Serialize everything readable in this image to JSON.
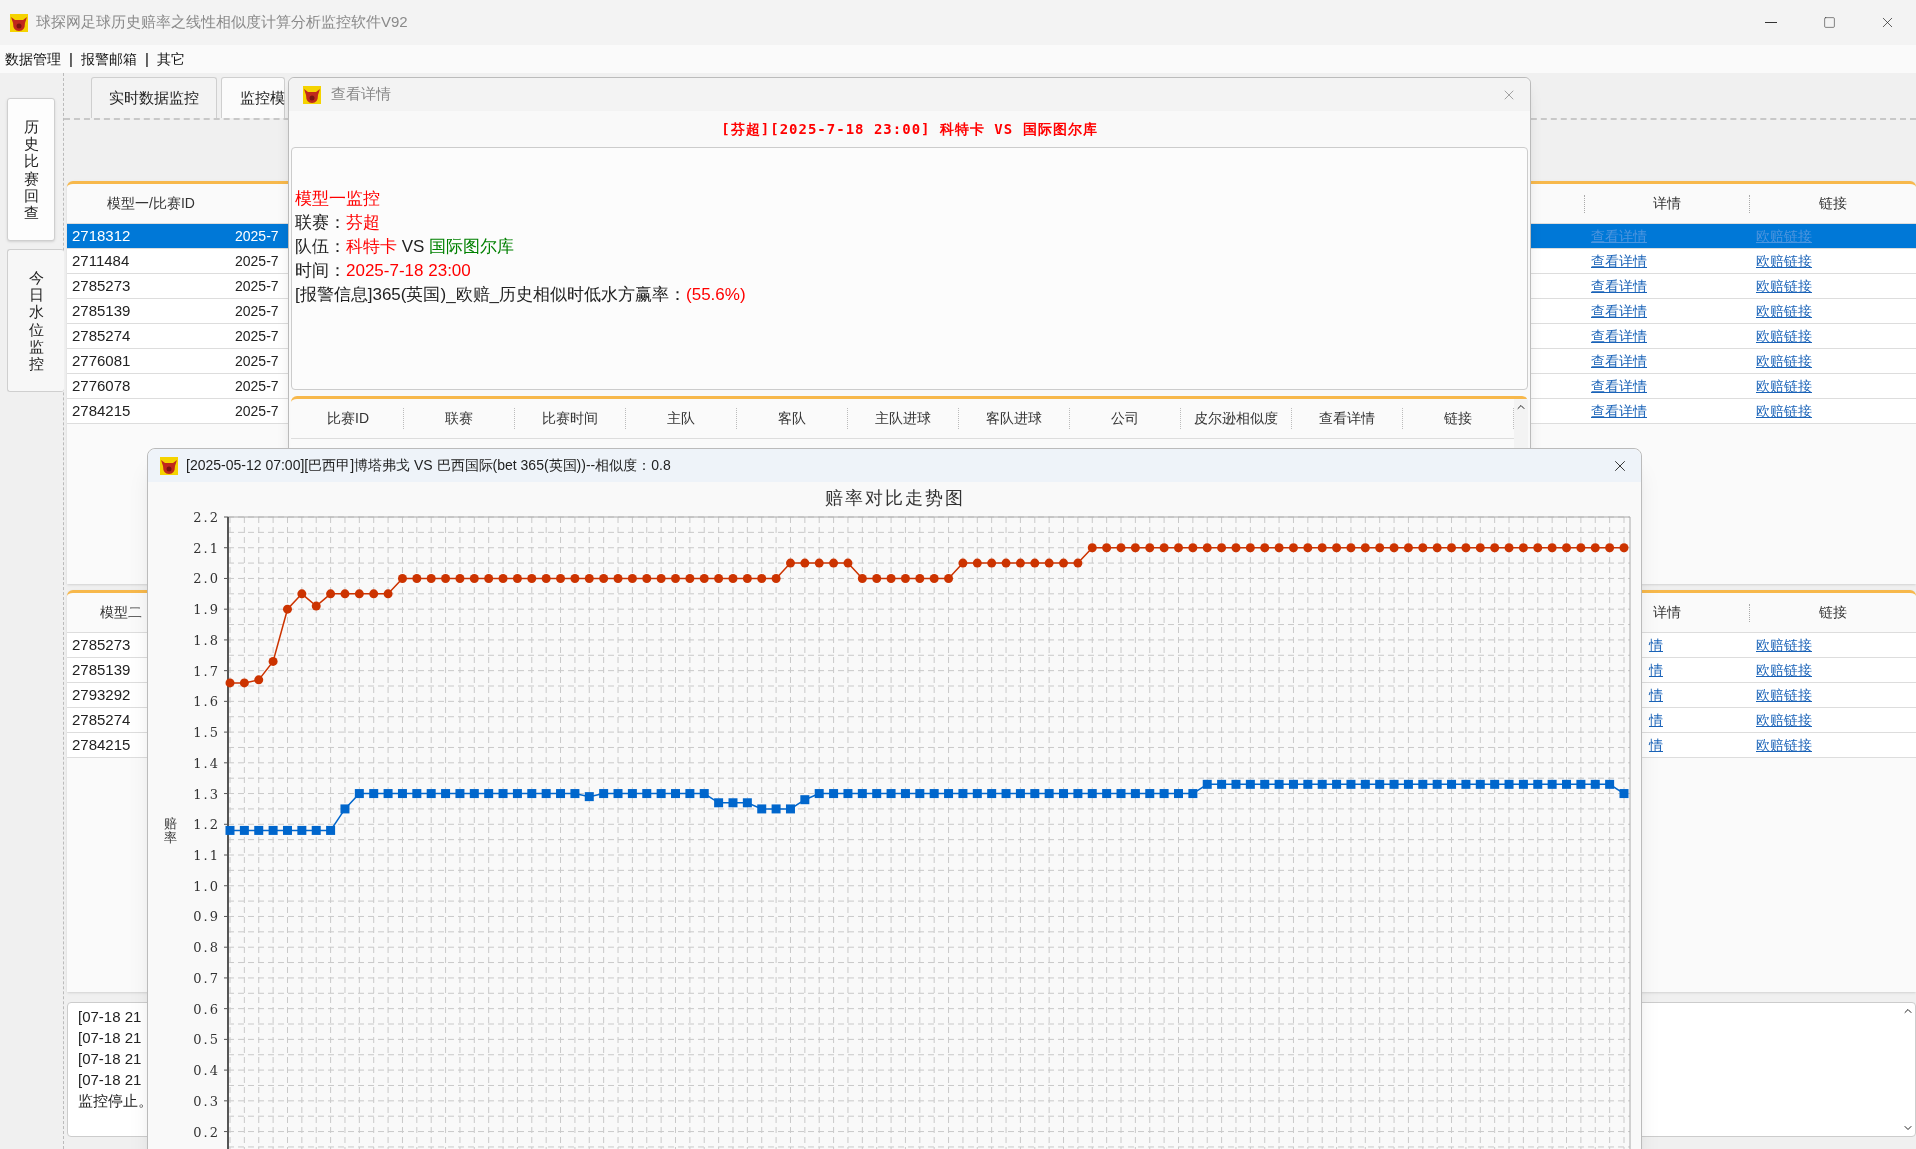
{
  "window": {
    "title": "球探网足球历史赔率之线性相似度计算分析监控软件V92"
  },
  "menu": [
    {
      "kind": "item",
      "label": "数据管理"
    },
    {
      "kind": "separator",
      "label": "|"
    },
    {
      "kind": "item",
      "label": "报警邮箱"
    },
    {
      "kind": "separator",
      "label": "|"
    },
    {
      "kind": "item",
      "label": "其它"
    }
  ],
  "side_tabs": [
    {
      "label": "历史比赛回查",
      "selected": false
    },
    {
      "label": "今日水位监控",
      "selected": true
    }
  ],
  "tabs": [
    {
      "label": "实时数据监控",
      "selected": true
    },
    {
      "label": "监控模",
      "selected": false
    }
  ],
  "table1": {
    "columns": [
      "模型一/比赛ID",
      "详情",
      "链接"
    ],
    "rows": [
      {
        "id": "2718312",
        "column_2": "2025-7",
        "detail": "查看详情",
        "link": "欧赔链接",
        "selected": true
      },
      {
        "id": "2711484",
        "column_2": "2025-7",
        "detail": "查看详情",
        "link": "欧赔链接",
        "selected": false
      },
      {
        "id": "2785273",
        "column_2": "2025-7",
        "detail": "查看详情",
        "link": "欧赔链接",
        "selected": false
      },
      {
        "id": "2785139",
        "column_2": "2025-7",
        "detail": "查看详情",
        "link": "欧赔链接",
        "selected": false
      },
      {
        "id": "2785274",
        "column_2": "2025-7",
        "detail": "查看详情",
        "link": "欧赔链接",
        "selected": false
      },
      {
        "id": "2776081",
        "column_2": "2025-7",
        "detail": "查看详情",
        "link": "欧赔链接",
        "selected": false
      },
      {
        "id": "2776078",
        "column_2": "2025-7",
        "detail": "查看详情",
        "link": "欧赔链接",
        "selected": false
      },
      {
        "id": "2784215",
        "column_2": "2025-7",
        "detail": "查看详情",
        "link": "欧赔链接",
        "selected": false
      }
    ]
  },
  "table2": {
    "columns": [
      "模型二",
      "详情",
      "链接"
    ],
    "rows": [
      {
        "id": "2785273",
        "detail": "情",
        "link": "欧赔链接"
      },
      {
        "id": "2785139",
        "detail": "情",
        "link": "欧赔链接"
      },
      {
        "id": "2793292",
        "detail": "情",
        "link": "欧赔链接"
      },
      {
        "id": "2785274",
        "detail": "情",
        "link": "欧赔链接"
      },
      {
        "id": "2784215",
        "detail": "情",
        "link": "欧赔链接"
      }
    ]
  },
  "log": [
    "[07-18 21",
    "[07-18 21",
    "[07-18 21",
    "[07-18 21",
    "监控停止。"
  ],
  "detail_dialog": {
    "title": "查看详情",
    "heading": "[芬超][2025-7-18 23:00] 科特卡 VS 国际图尔库",
    "lines": [
      {
        "segments": [
          {
            "text": "模型一监控",
            "color": "#ff0000"
          }
        ]
      },
      {
        "segments": [
          {
            "text": "联赛：",
            "color": "#222222"
          },
          {
            "text": "芬超",
            "color": "#ff0000"
          }
        ]
      },
      {
        "segments": [
          {
            "text": "队伍：",
            "color": "#222222"
          },
          {
            "text": "科特卡",
            "color": "#ff0000"
          },
          {
            "text": " VS ",
            "color": "#222222"
          },
          {
            "text": "国际图尔库",
            "color": "#008000"
          }
        ]
      },
      {
        "segments": [
          {
            "text": "时间：",
            "color": "#222222"
          },
          {
            "text": "2025-7-18 23:00",
            "color": "#ff0000"
          }
        ]
      },
      {
        "segments": [
          {
            "text": "[报警信息]365(英国)_欧赔_历史相似时低水方赢率：",
            "color": "#222222"
          },
          {
            "text": "(55.6%)",
            "color": "#ff0000"
          }
        ]
      }
    ],
    "columns": [
      "比赛ID",
      "联赛",
      "比赛时间",
      "主队",
      "客队",
      "主队进球",
      "客队进球",
      "公司",
      "皮尔逊相似度",
      "查看详情",
      "链接"
    ]
  },
  "chart_dialog": {
    "title": "[2025-05-12 07:00][巴西甲]博塔弗戈 VS 巴西国际(bet 365(英国))--相似度：0.8",
    "chart_data": {
      "type": "line",
      "grid": true,
      "title": "赔率对比走势图",
      "ylabel": "赔率",
      "ylim": [
        0.14,
        2.2
      ],
      "yticks": [
        {
          "value": 2.2,
          "label": "2.2"
        },
        {
          "value": 2.1,
          "label": "2.1"
        },
        {
          "value": 2.0,
          "label": "2.0"
        },
        {
          "value": 1.9,
          "label": "1.9"
        },
        {
          "value": 1.8,
          "label": "1.8"
        },
        {
          "value": 1.7,
          "label": "1.7"
        },
        {
          "value": 1.6,
          "label": "1.6"
        },
        {
          "value": 1.5,
          "label": "1.5"
        },
        {
          "value": 1.4,
          "label": "1.4"
        },
        {
          "value": 1.3,
          "label": "1.3"
        },
        {
          "value": 1.2,
          "label": "1.2"
        },
        {
          "value": 1.1,
          "label": "1.1"
        },
        {
          "value": 1.0,
          "label": "1.0"
        },
        {
          "value": 0.9,
          "label": "0.9"
        },
        {
          "value": 0.8,
          "label": "0.8"
        },
        {
          "value": 0.7,
          "label": "0.7"
        },
        {
          "value": 0.6,
          "label": "0.6"
        },
        {
          "value": 0.5,
          "label": "0.5"
        },
        {
          "value": 0.4,
          "label": "0.4"
        },
        {
          "value": 0.3,
          "label": "0.3"
        },
        {
          "value": 0.2,
          "label": "0.2"
        }
      ],
      "series": [
        {
          "color": "#cc3300",
          "marker": "circle",
          "values": [
            1.66,
            1.66,
            1.67,
            1.73,
            1.9,
            1.95,
            1.91,
            1.95,
            1.95,
            1.95,
            1.95,
            1.95,
            2.0,
            2.0,
            2.0,
            2.0,
            2.0,
            2.0,
            2.0,
            2.0,
            2.0,
            2.0,
            2.0,
            2.0,
            2.0,
            2.0,
            2.0,
            2.0,
            2.0,
            2.0,
            2.0,
            2.0,
            2.0,
            2.0,
            2.0,
            2.0,
            2.0,
            2.0,
            2.0,
            2.05,
            2.05,
            2.05,
            2.05,
            2.05,
            2.0,
            2.0,
            2.0,
            2.0,
            2.0,
            2.0,
            2.0,
            2.05,
            2.05,
            2.05,
            2.05,
            2.05,
            2.05,
            2.05,
            2.05,
            2.05,
            2.1,
            2.1,
            2.1,
            2.1,
            2.1,
            2.1,
            2.1,
            2.1,
            2.1,
            2.1,
            2.1,
            2.1,
            2.1,
            2.1,
            2.1,
            2.1,
            2.1,
            2.1,
            2.1,
            2.1,
            2.1,
            2.1,
            2.1,
            2.1,
            2.1,
            2.1,
            2.1,
            2.1,
            2.1,
            2.1,
            2.1,
            2.1,
            2.1,
            2.1,
            2.1,
            2.1,
            2.1,
            2.1
          ]
        },
        {
          "color": "#0066cc",
          "marker": "square",
          "values": [
            1.18,
            1.18,
            1.18,
            1.18,
            1.18,
            1.18,
            1.18,
            1.18,
            1.25,
            1.3,
            1.3,
            1.3,
            1.3,
            1.3,
            1.3,
            1.3,
            1.3,
            1.3,
            1.3,
            1.3,
            1.3,
            1.3,
            1.3,
            1.3,
            1.3,
            1.29,
            1.3,
            1.3,
            1.3,
            1.3,
            1.3,
            1.3,
            1.3,
            1.3,
            1.27,
            1.27,
            1.27,
            1.25,
            1.25,
            1.25,
            1.28,
            1.3,
            1.3,
            1.3,
            1.3,
            1.3,
            1.3,
            1.3,
            1.3,
            1.3,
            1.3,
            1.3,
            1.3,
            1.3,
            1.3,
            1.3,
            1.3,
            1.3,
            1.3,
            1.3,
            1.3,
            1.3,
            1.3,
            1.3,
            1.3,
            1.3,
            1.3,
            1.3,
            1.33,
            1.33,
            1.33,
            1.33,
            1.33,
            1.33,
            1.33,
            1.33,
            1.33,
            1.33,
            1.33,
            1.33,
            1.33,
            1.33,
            1.33,
            1.33,
            1.33,
            1.33,
            1.33,
            1.33,
            1.33,
            1.33,
            1.33,
            1.33,
            1.33,
            1.33,
            1.33,
            1.33,
            1.33,
            1.3
          ]
        }
      ]
    }
  }
}
